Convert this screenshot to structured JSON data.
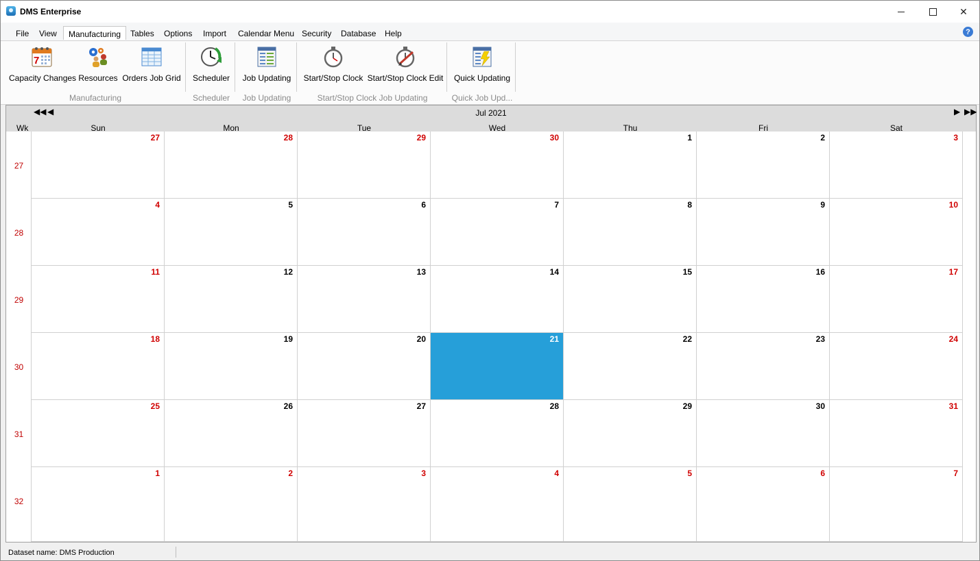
{
  "window": {
    "title": "DMS Enterprise"
  },
  "menu": {
    "items": [
      "File",
      "View",
      "Manufacturing",
      "Tables",
      "Options",
      "Import",
      "Calendar Menu",
      "Security",
      "Database",
      "Help"
    ],
    "active": "Manufacturing"
  },
  "ribbon": {
    "buttons": {
      "capacity_changes": "Capacity Changes",
      "resources": "Resources",
      "orders_job_grid": "Orders Job Grid",
      "scheduler": "Scheduler",
      "job_updating": "Job Updating",
      "start_stop_clock": "Start/Stop Clock",
      "start_stop_clock_edit": "Start/Stop Clock Edit",
      "quick_updating": "Quick Updating"
    },
    "groups": {
      "manufacturing": "Manufacturing",
      "scheduler": "Scheduler",
      "job_updating": "Job Updating",
      "start_stop": "Start/Stop Clock Job Updating",
      "quick": "Quick Job Upd..."
    },
    "calendar_icon_day": "7"
  },
  "calendar": {
    "month_label": "Jul 2021",
    "wk_header": "Wk",
    "days": [
      "Sun",
      "Mon",
      "Tue",
      "Wed",
      "Thu",
      "Fri",
      "Sat"
    ],
    "weeks": [
      {
        "wk": "27",
        "dates": [
          "27",
          "28",
          "29",
          "30",
          "1",
          "2",
          "3"
        ],
        "outside": [
          true,
          true,
          true,
          true,
          false,
          false,
          true
        ]
      },
      {
        "wk": "28",
        "dates": [
          "4",
          "5",
          "6",
          "7",
          "8",
          "9",
          "10"
        ],
        "outside": [
          true,
          false,
          false,
          false,
          false,
          false,
          true
        ]
      },
      {
        "wk": "29",
        "dates": [
          "11",
          "12",
          "13",
          "14",
          "15",
          "16",
          "17"
        ],
        "outside": [
          true,
          false,
          false,
          false,
          false,
          false,
          true
        ]
      },
      {
        "wk": "30",
        "dates": [
          "18",
          "19",
          "20",
          "21",
          "22",
          "23",
          "24"
        ],
        "outside": [
          true,
          false,
          false,
          false,
          false,
          false,
          true
        ]
      },
      {
        "wk": "31",
        "dates": [
          "25",
          "26",
          "27",
          "28",
          "29",
          "30",
          "31"
        ],
        "outside": [
          true,
          false,
          false,
          false,
          false,
          false,
          true
        ]
      },
      {
        "wk": "32",
        "dates": [
          "1",
          "2",
          "3",
          "4",
          "5",
          "6",
          "7"
        ],
        "outside": [
          true,
          true,
          true,
          true,
          true,
          true,
          true
        ]
      }
    ],
    "selected_date": "21",
    "colors": {
      "selected": "#269fd9",
      "weekend": "#d00000",
      "week_number": "#c00000"
    }
  },
  "status": {
    "dataset": "Dataset name:  DMS Production"
  }
}
